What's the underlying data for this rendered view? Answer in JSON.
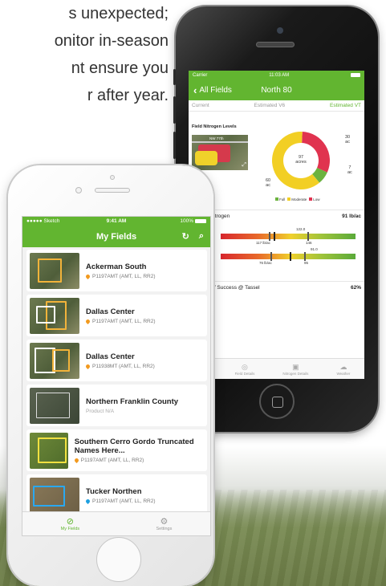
{
  "intro": {
    "lines": [
      "s unexpected;",
      "onitor in-season",
      "nt ensure you",
      "r after year."
    ]
  },
  "back_phone": {
    "status": {
      "carrier": "Carrier",
      "time": "11:03 AM"
    },
    "nav": {
      "back_label": "All Fields",
      "title": "North 80"
    },
    "tabs": [
      "Current",
      "Estimated V6",
      "Estimated VT"
    ],
    "section_title": "Field Nitrogen Levels",
    "map_label": "NW 77th",
    "donut": {
      "center_value": "97",
      "center_unit": "acres",
      "slices": [
        {
          "label": "Full",
          "value": 7,
          "color": "#6cb33f"
        },
        {
          "label": "Moderate",
          "value": 60,
          "color": "#f2cf24"
        },
        {
          "label": "Low",
          "value": 30,
          "color": "#e0334f"
        }
      ],
      "labels": {
        "low_top": "30",
        "full_right": "7",
        "moderate_left": "60",
        "unit": "ac"
      }
    },
    "legend": [
      "Full",
      "Moderate",
      "Low"
    ],
    "soil_nitrogen": {
      "label": "VT Soil Nitrogen",
      "value": "91 lb/ac"
    },
    "bars": [
      {
        "marker_value": "122.0",
        "low_label": "117 lb/ac",
        "high_label": "146"
      },
      {
        "marker_value": "91.0",
        "low_label": "76 lb/ac",
        "high_label": "95"
      }
    ],
    "chance": {
      "label": "Chance of Success @ Tassel",
      "value": "62%"
    },
    "bottom_tabs": [
      "Field Details",
      "Nitrogen Details",
      "Weather"
    ]
  },
  "front_phone": {
    "status": {
      "carrier": "Sketch",
      "time": "9:41 AM",
      "battery": "100%"
    },
    "nav": {
      "title": "My Fields"
    },
    "fields": [
      {
        "name": "Ackerman South",
        "product": "P1197AMT (AMT, LL, RR2)",
        "drop_color": "#f29a1f",
        "outline": "#f2b33a"
      },
      {
        "name": "Dallas Center",
        "product": "P1197AMT (AMT, LL, RR2)",
        "drop_color": "#f29a1f",
        "outline": "#f2b33a"
      },
      {
        "name": "Dallas Center",
        "product": "P11938MT (AMT, LL, RR2)",
        "drop_color": "#f29a1f",
        "outline": "#ffffff"
      },
      {
        "name": "Northern Franklin County",
        "product": "Product N/A",
        "drop_color": "",
        "outline": "#dddddd"
      },
      {
        "name": "Southern Cerro Gordo Truncated Names Here...",
        "product": "P1197AMT (AMT, LL, RR2)",
        "drop_color": "#f29a1f",
        "outline": "#f0e040"
      },
      {
        "name": "Tucker Northen",
        "product": "P1197AMT (AMT, LL, RR2)",
        "drop_color": "#1fa0e0",
        "outline": "#2aa8f0"
      }
    ],
    "tabbar": [
      {
        "label": "My Fields",
        "active": true
      },
      {
        "label": "Settings",
        "active": false
      }
    ]
  },
  "colors": {
    "brand_green": "#62b530"
  }
}
